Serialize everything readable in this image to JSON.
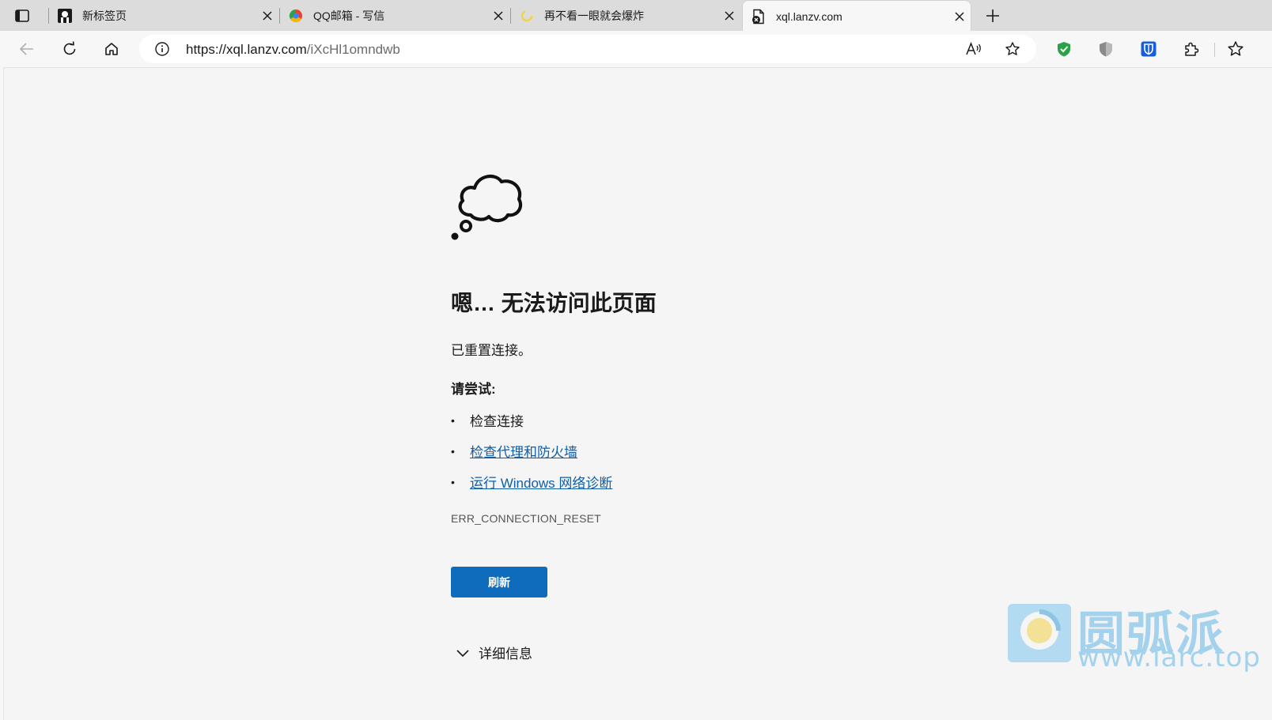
{
  "tabs": [
    {
      "title": "新标签页",
      "icon": "profile-favicon-icon"
    },
    {
      "title": "QQ邮箱 - 写信",
      "icon": "qq-mail-favicon-icon"
    },
    {
      "title": "再不看一眼就会爆炸",
      "icon": "loading-favicon-icon"
    },
    {
      "title": "xql.lanzv.com",
      "icon": "error-page-favicon-icon",
      "active": true
    }
  ],
  "toolbar": {
    "url_host": "https://xql.lanzv.com",
    "url_path": "/iXcHl1omndwb"
  },
  "error": {
    "title": "嗯… 无法访问此页面",
    "description": "已重置连接。",
    "try_label": "请尝试:",
    "suggestions": [
      {
        "text": "检查连接",
        "link": false
      },
      {
        "text": "检查代理和防火墙",
        "link": true
      },
      {
        "text": "运行 Windows 网络诊断",
        "link": true
      }
    ],
    "code": "ERR_CONNECTION_RESET",
    "refresh_label": "刷新",
    "details_label": "详细信息"
  },
  "watermark": {
    "name": "圆弧派",
    "url": "www.iarc.top"
  },
  "colors": {
    "accent": "#0f6cbd",
    "link": "#0f5ea6",
    "tabstrip": "#dcdcdc",
    "page_bg": "#f5f5f5",
    "shield_green": "#2aa24a",
    "bitwarden_blue": "#175ddc",
    "watermark": "#62b6e8"
  }
}
